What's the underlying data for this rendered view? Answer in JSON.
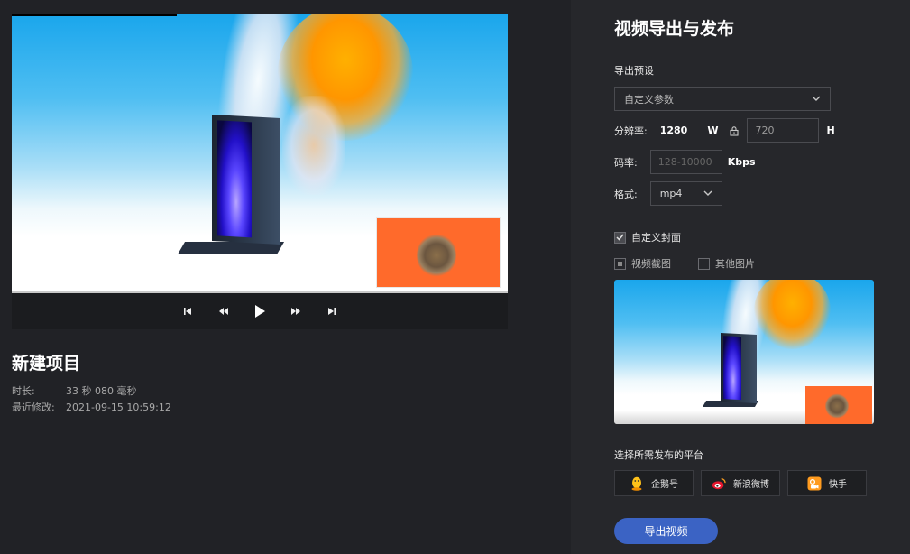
{
  "project": {
    "title": "新建项目",
    "duration_label": "时长:",
    "duration_value": "33 秒 080 毫秒",
    "modified_label": "最近修改:",
    "modified_value": "2021-09-15 10:59:12"
  },
  "player": {
    "controls": [
      "skip-to-start",
      "rewind",
      "play",
      "fast-forward",
      "skip-to-end"
    ]
  },
  "export": {
    "title": "视频导出与发布",
    "preset_label": "导出预设",
    "preset_value": "自定义参数",
    "resolution_label": "分辨率:",
    "width_value": "1280",
    "width_unit": "W",
    "height_value": "720",
    "height_unit": "H",
    "bitrate_label": "码率:",
    "bitrate_placeholder": "128-10000",
    "bitrate_unit": "Kbps",
    "format_label": "格式:",
    "format_value": "mp4",
    "custom_cover_label": "自定义封面",
    "cover_option_screenshot": "视频截图",
    "cover_option_other": "其他图片",
    "platform_title": "选择所需发布的平台",
    "platforms": [
      {
        "label": "企鹅号",
        "icon": "penguin-icon"
      },
      {
        "label": "新浪微博",
        "icon": "weibo-icon"
      },
      {
        "label": "快手",
        "icon": "kuaishou-icon"
      }
    ],
    "export_button": "导出视频"
  },
  "colors": {
    "accent": "#3b63c4",
    "background": "#212226",
    "panel": "#26272b"
  }
}
